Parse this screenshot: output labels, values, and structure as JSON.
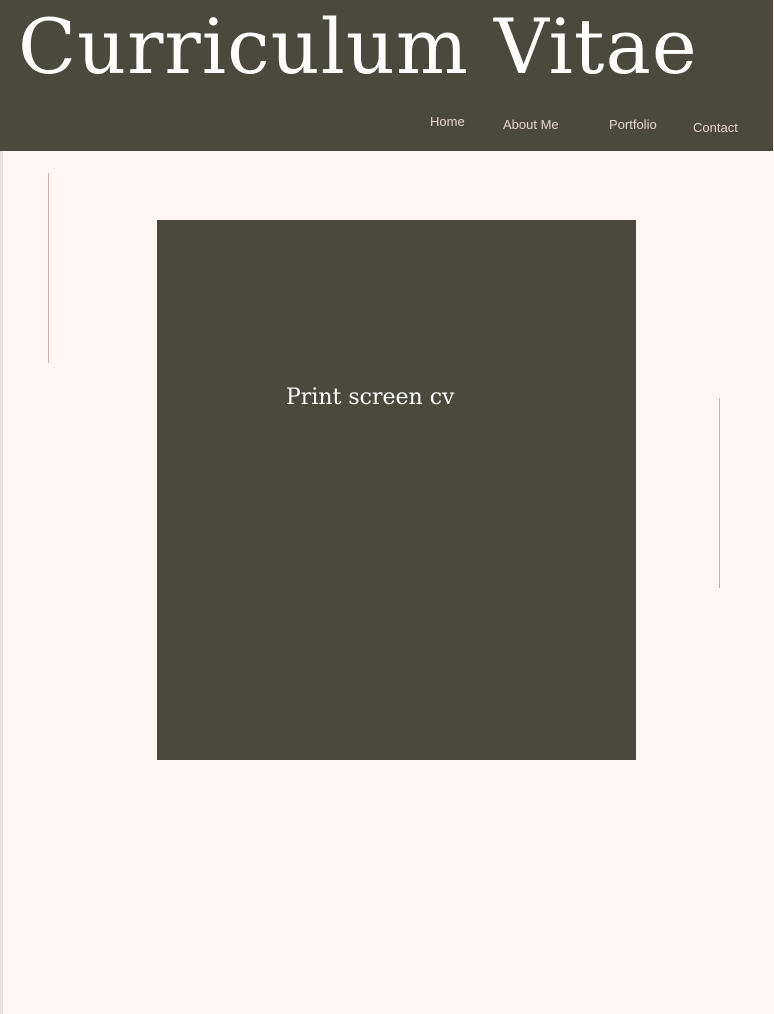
{
  "header": {
    "title": "Curriculum Vitae"
  },
  "nav": {
    "items": [
      {
        "label": "Home"
      },
      {
        "label": "About Me"
      },
      {
        "label": "Portfolio"
      },
      {
        "label": "Contact"
      }
    ]
  },
  "main": {
    "cv_caption": "Print screen cv"
  },
  "colors": {
    "header_bg": "#4b483d",
    "page_bg": "#fdf6f4",
    "nav_text": "#e7d5cf",
    "accent_line": "#d8aea4",
    "title_text": "#ffffff"
  }
}
